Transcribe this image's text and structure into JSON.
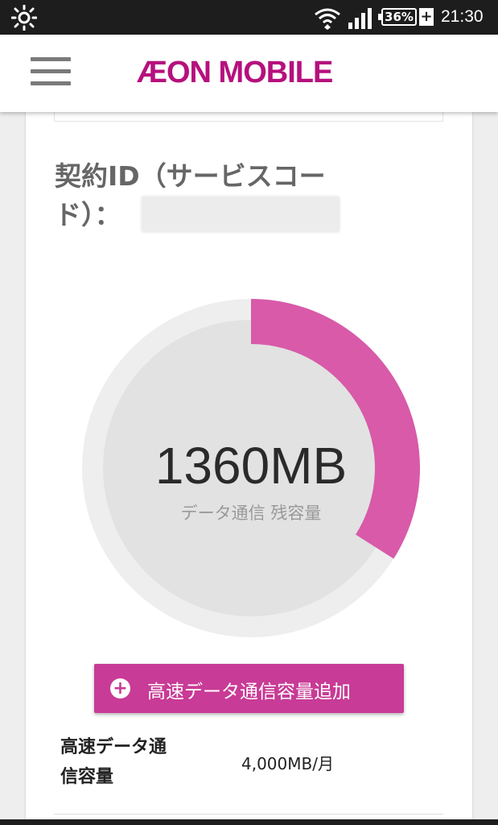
{
  "status_bar": {
    "battery": "36%",
    "charging": "+",
    "time": "21:30",
    "icons": [
      "brightness-icon",
      "wifi-icon",
      "signal-icon",
      "battery-icon"
    ]
  },
  "header": {
    "brand": "ÆON MOBILE",
    "brand_color": "#b5117d"
  },
  "contract": {
    "label": "契約ID（サービスコード）：",
    "value": ""
  },
  "usage": {
    "remaining": "1360MB",
    "remaining_label": "データ通信 残容量",
    "remaining_fraction": 0.34,
    "ring_color": "#d85aa9",
    "track_color": "#eeeeee",
    "inner_color": "#e2e2e2"
  },
  "add_button": {
    "label": "高速データ通信容量追加",
    "color": "#c83b96",
    "icon": "plus-circle-icon"
  },
  "spec": {
    "label": "高速データ通信容量",
    "value": "4,000MB/月"
  }
}
